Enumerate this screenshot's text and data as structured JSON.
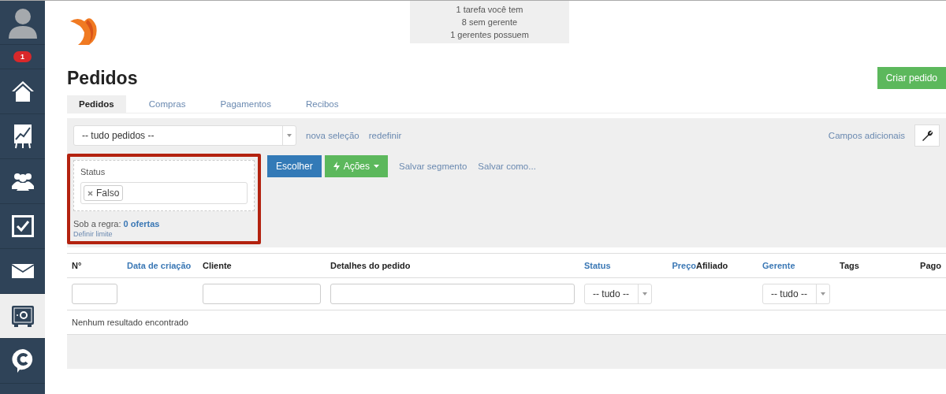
{
  "sidebar": {
    "badge": "1",
    "items": [
      {
        "kind": "home",
        "selected": false
      },
      {
        "kind": "chart",
        "selected": false
      },
      {
        "kind": "people",
        "selected": false
      },
      {
        "kind": "check",
        "selected": false
      },
      {
        "kind": "mail",
        "selected": false
      },
      {
        "kind": "safe",
        "selected": true
      },
      {
        "kind": "chat",
        "selected": false
      }
    ]
  },
  "summary": [
    "1 tarefa você tem",
    "8 sem gerente",
    "1 gerentes possuem"
  ],
  "title": "Pedidos",
  "create_button": "Criar pedido",
  "tabs": [
    {
      "label": "Pedidos",
      "selected": true
    },
    {
      "label": "Compras",
      "selected": false
    },
    {
      "label": "Pagamentos",
      "selected": false
    },
    {
      "label": "Recibos",
      "selected": false
    }
  ],
  "toolbar": {
    "segment_select": "-- tudo pedidos --",
    "links": [
      "nova seleção",
      "redefinir"
    ],
    "extra_fields": "Campos adicionais"
  },
  "filter": {
    "highlighted": true,
    "label": "Status",
    "tags": [
      "Falso"
    ],
    "rule_label": "Sob a regra:",
    "rule_count": "0 ofertas",
    "limit_link": "Definir limite"
  },
  "actions": {
    "choose": "Escolher",
    "actions": "Ações",
    "links": [
      "Salvar segmento",
      "Salvar como..."
    ]
  },
  "table": {
    "columns": [
      {
        "label": "N°",
        "sortable": false,
        "kind": "input"
      },
      {
        "label": "Data de criação",
        "sortable": true,
        "kind": "none"
      },
      {
        "label": "Cliente",
        "sortable": false,
        "kind": "input"
      },
      {
        "label": "Detalhes do pedido",
        "sortable": false,
        "kind": "input"
      },
      {
        "label": "Status",
        "sortable": true,
        "kind": "select",
        "value": "-- tudo --"
      },
      {
        "label": "Preço",
        "sortable": true,
        "kind": "none"
      },
      {
        "label": "Afiliado",
        "sortable": false,
        "kind": "none"
      },
      {
        "label": "Gerente",
        "sortable": true,
        "kind": "select",
        "value": "-- tudo --"
      },
      {
        "label": "Tags",
        "sortable": false,
        "kind": "none"
      },
      {
        "label": "Pago",
        "sortable": false,
        "kind": "none"
      }
    ],
    "empty_message": "Nenhum resultado encontrado"
  }
}
